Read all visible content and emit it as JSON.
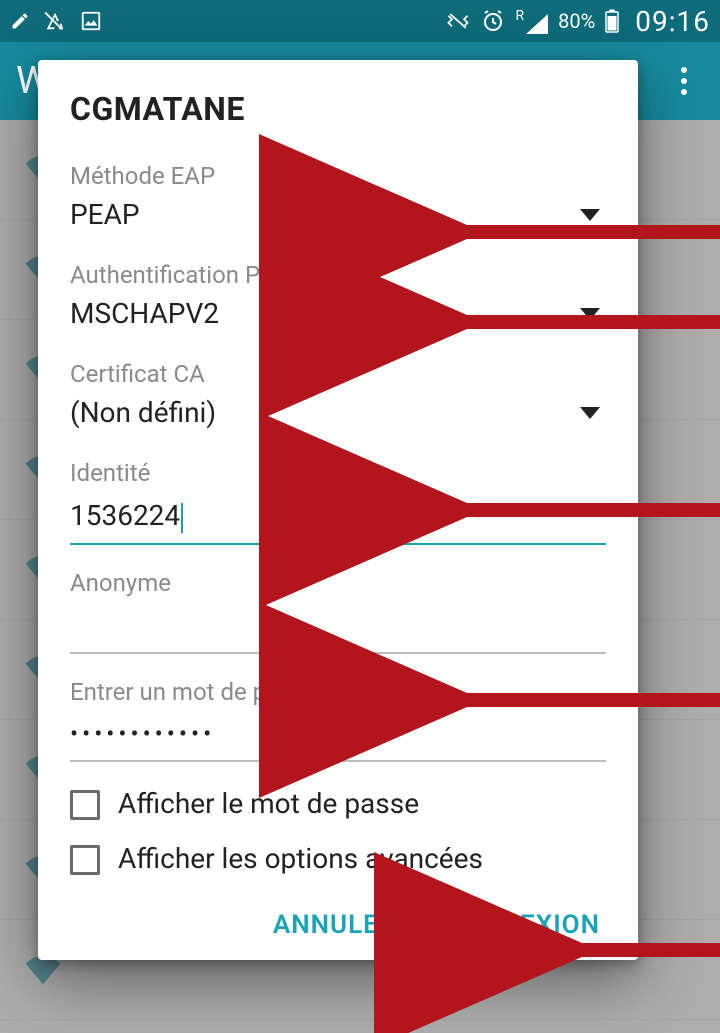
{
  "status": {
    "battery_pct": "80%",
    "clock": "09:16",
    "signal_prefix": "R"
  },
  "toolbar": {
    "title_fragment": "W"
  },
  "dialog": {
    "title": "CGMATANE",
    "eap": {
      "label": "Méthode EAP",
      "value": "PEAP"
    },
    "phase2": {
      "label": "Authentification Phase 2",
      "value": "MSCHAPV2"
    },
    "ca": {
      "label": "Certificat CA",
      "value": "(Non défini)"
    },
    "identity": {
      "label": "Identité",
      "value": "1536224"
    },
    "anonymous": {
      "label": "Anonyme",
      "value": ""
    },
    "password": {
      "label": "Entrer un mot de passe",
      "mask": "••••••••••••"
    },
    "show_password": "Afficher le mot de passe",
    "show_advanced": "Afficher les options avancées",
    "cancel": "ANNULER",
    "connect": "CONNEXION"
  }
}
